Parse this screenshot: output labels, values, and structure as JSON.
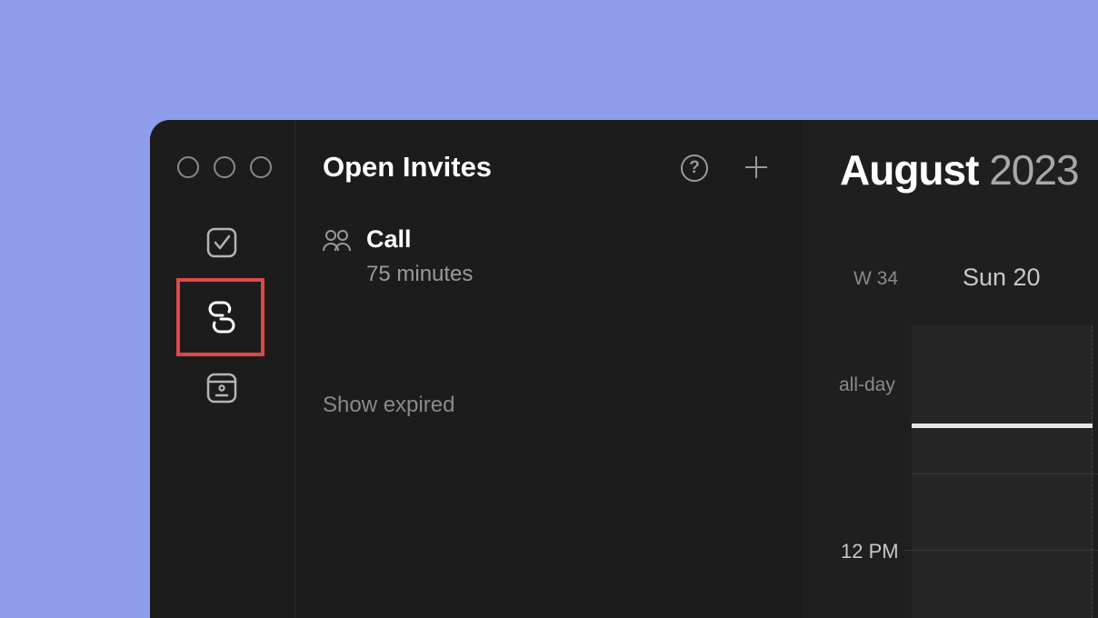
{
  "sidebar": {
    "window_controls": [
      "close",
      "minimize",
      "zoom"
    ],
    "items": [
      {
        "name": "tasks",
        "icon": "checkbox-icon"
      },
      {
        "name": "invites",
        "icon": "link-icon",
        "selected": true
      },
      {
        "name": "contacts",
        "icon": "contact-card-icon"
      }
    ]
  },
  "panel": {
    "title": "Open Invites",
    "help_icon": "question-circle-icon",
    "add_icon": "plus-icon",
    "help_glyph": "?",
    "invites": [
      {
        "title": "Call",
        "duration": "75 minutes",
        "icon": "people-icon"
      }
    ],
    "show_expired": "Show expired"
  },
  "calendar": {
    "month": "August",
    "year": "2023",
    "week": "W 34",
    "day": "Sun 20",
    "all_day": "all-day",
    "time": "12 PM"
  },
  "colors": {
    "background": "#8f9dec",
    "window": "#1c1c1c",
    "highlight": "#e04848"
  }
}
